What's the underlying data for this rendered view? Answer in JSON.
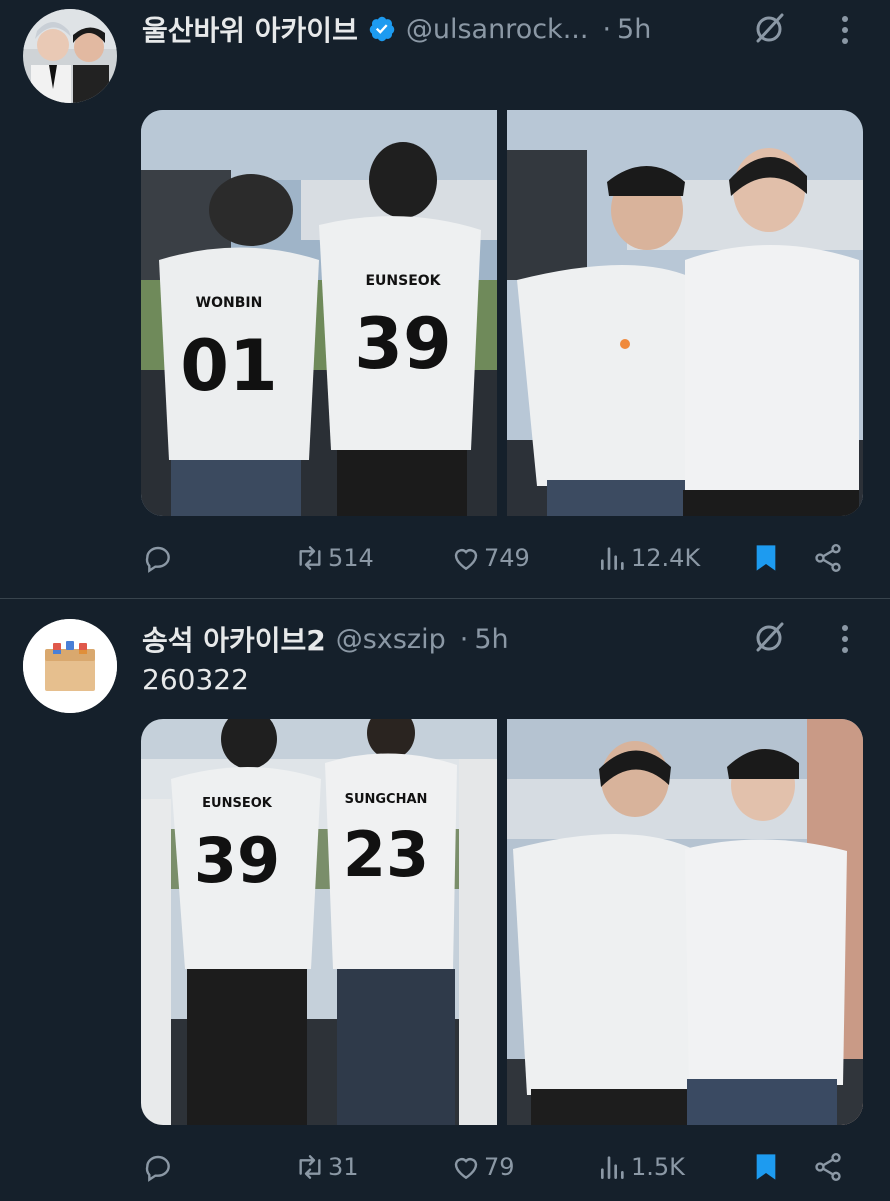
{
  "tweets": [
    {
      "name": "울산바위 아카이브",
      "verified": true,
      "handle": "@ulsanrock...",
      "dot": "·",
      "time": "5h",
      "text": "",
      "replies": "",
      "retweets": "514",
      "likes": "749",
      "views": "12.4K",
      "bookmarked": true,
      "photos": [
        {
          "jerseys": [
            {
              "name": "WONBIN",
              "number": "01"
            },
            {
              "name": "EUNSEOK",
              "number": "39"
            }
          ]
        },
        {
          "jerseys": []
        }
      ]
    },
    {
      "name": "송석 아카이브2",
      "verified": false,
      "handle": "@sxszip",
      "dot": "·",
      "time": "5h",
      "text": "260322",
      "replies": "",
      "retweets": "31",
      "likes": "79",
      "views": "1.5K",
      "bookmarked": true,
      "photos": [
        {
          "jerseys": [
            {
              "name": "EUNSEOK",
              "number": "39"
            },
            {
              "name": "SUNGCHAN",
              "number": "23"
            }
          ]
        },
        {
          "jerseys": []
        }
      ]
    }
  ],
  "colors": {
    "background": "#15202b",
    "verified": "#1d9bf0",
    "bookmark": "#1d9bf0",
    "secondary_text": "#8b98a5",
    "divider": "#38444d"
  },
  "icons": [
    "reply-icon",
    "retweet-icon",
    "like-icon",
    "views-icon",
    "bookmark-icon",
    "share-icon",
    "grok-icon",
    "more-icon",
    "verified-badge-icon"
  ]
}
